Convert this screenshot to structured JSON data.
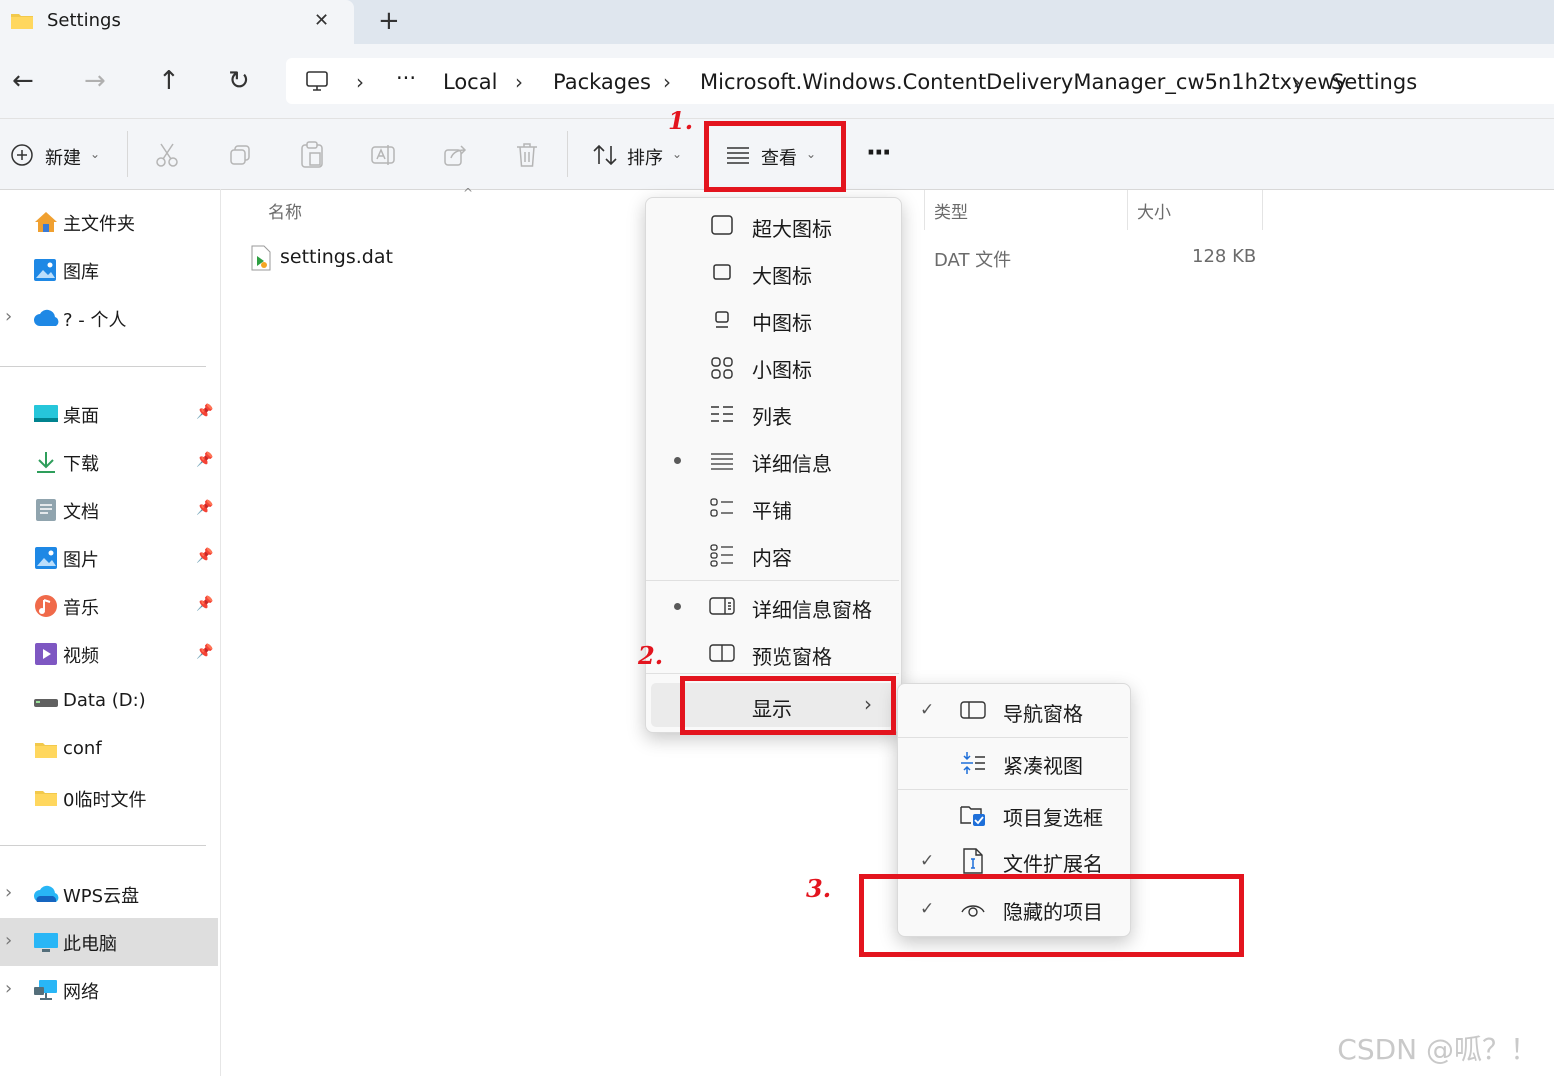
{
  "window": {
    "tab_title": "Settings",
    "close_glyph": "✕",
    "new_tab_glyph": "+"
  },
  "nav_buttons": [
    "←",
    "→",
    "↑",
    "↻"
  ],
  "breadcrumb": {
    "ellipsis": "···",
    "items": [
      "Local",
      "Packages",
      "Microsoft.Windows.ContentDeliveryManager_cw5n1h2txyewy",
      "Settings"
    ],
    "separator": "›"
  },
  "toolbar": {
    "new_label": "新建",
    "sort_label": "排序",
    "view_label": "查看",
    "more_glyph": "···"
  },
  "sidebar": {
    "top": [
      {
        "label": "主文件夹",
        "icon": "home-icon"
      },
      {
        "label": "图库",
        "icon": "gallery-icon"
      },
      {
        "label": "? - 个人",
        "icon": "onedrive-icon"
      }
    ],
    "quick": [
      {
        "label": "桌面",
        "icon": "desktop-icon"
      },
      {
        "label": "下载",
        "icon": "download-icon"
      },
      {
        "label": "文档",
        "icon": "documents-icon"
      },
      {
        "label": "图片",
        "icon": "pictures-icon"
      },
      {
        "label": "音乐",
        "icon": "music-icon"
      },
      {
        "label": "视频",
        "icon": "videos-icon"
      },
      {
        "label": "Data (D:)",
        "icon": "drive-icon"
      },
      {
        "label": "conf",
        "icon": "folder-icon"
      },
      {
        "label": "0临时文件",
        "icon": "folder-icon"
      }
    ],
    "bottom": [
      {
        "label": "WPS云盘",
        "icon": "cloud-icon"
      },
      {
        "label": "此电脑",
        "icon": "computer-icon"
      },
      {
        "label": "网络",
        "icon": "network-icon"
      }
    ]
  },
  "columns": {
    "name": "名称",
    "type": "类型",
    "size": "大小"
  },
  "files": [
    {
      "name": "settings.dat",
      "type": "DAT 文件",
      "size": "128 KB"
    }
  ],
  "view_menu": {
    "items": [
      "超大图标",
      "大图标",
      "中图标",
      "小图标",
      "列表",
      "详细信息",
      "平铺",
      "内容"
    ],
    "selected_layout": "详细信息",
    "panes": [
      "详细信息窗格",
      "预览窗格"
    ],
    "selected_pane": "详细信息窗格",
    "show_label": "显示"
  },
  "show_submenu": {
    "items": [
      {
        "label": "导航窗格",
        "checked": true
      },
      {
        "label": "紧凑视图",
        "checked": false
      },
      {
        "label": "项目复选框",
        "checked": false
      },
      {
        "label": "文件扩展名",
        "checked": true
      },
      {
        "label": "隐藏的项目",
        "checked": true
      }
    ],
    "check_glyph": "✓"
  },
  "annotations": {
    "step1": "1.",
    "step2": "2.",
    "step3": "3.",
    "color": "#e3141e"
  },
  "watermark": "CSDN @呱？！"
}
